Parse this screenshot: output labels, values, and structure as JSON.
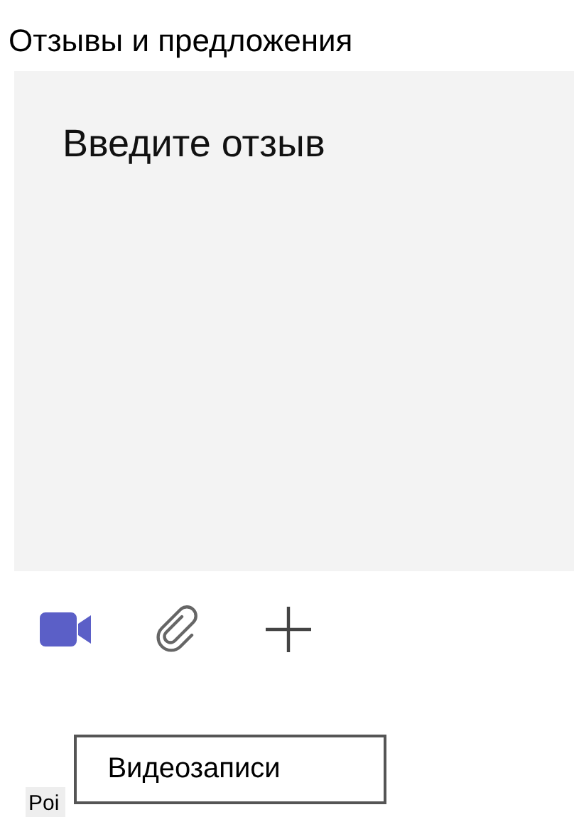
{
  "title": "Отзывы и предложения",
  "feedback_field": {
    "placeholder": "Введите отзыв"
  },
  "toolbar": [
    {
      "kind": "video"
    },
    {
      "kind": "attach"
    },
    {
      "kind": "add"
    }
  ],
  "tooltip": {
    "text": "Видеозаписи"
  },
  "label": "Poi"
}
